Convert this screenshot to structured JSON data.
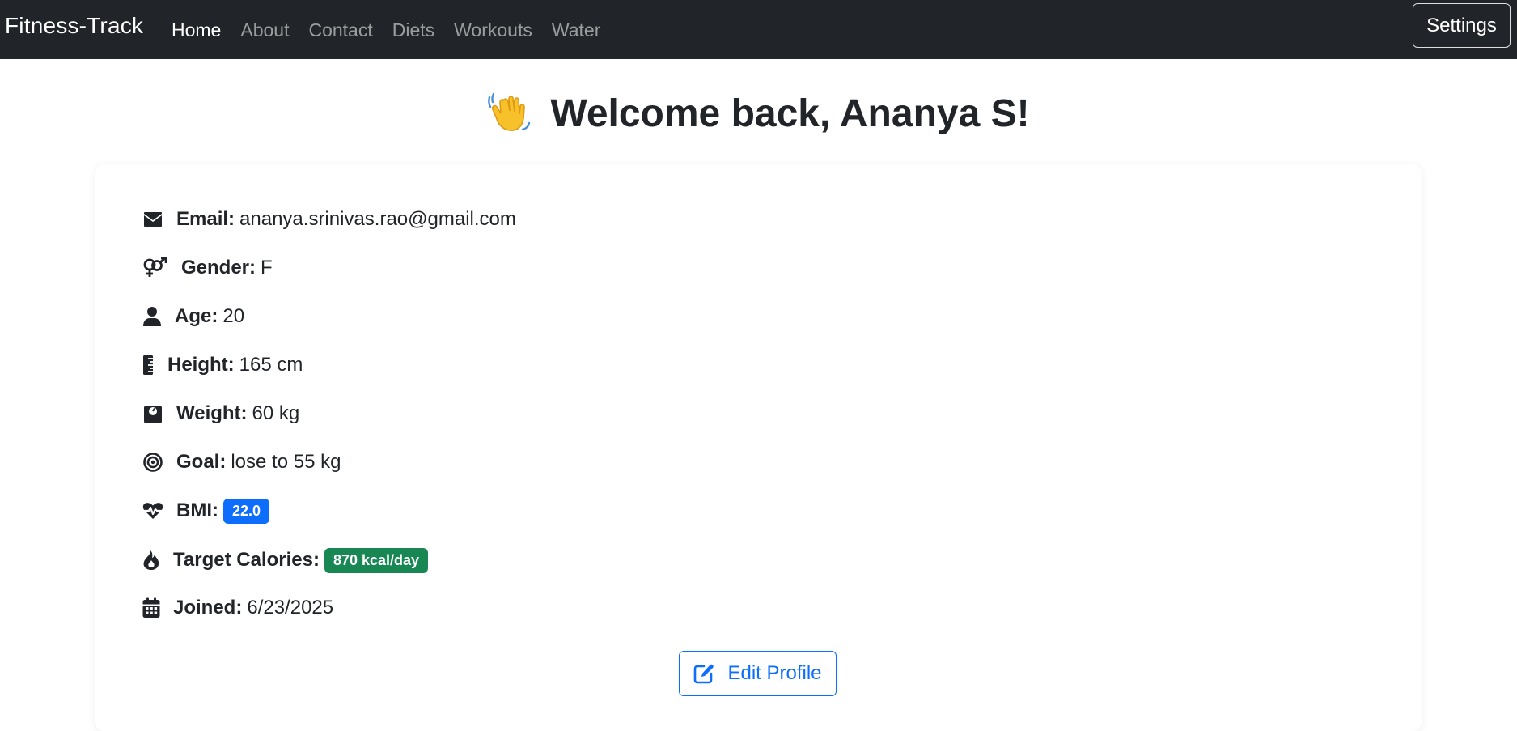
{
  "navbar": {
    "brand": "Fitness-Track",
    "links": [
      {
        "label": "Home",
        "active": true
      },
      {
        "label": "About",
        "active": false
      },
      {
        "label": "Contact",
        "active": false
      },
      {
        "label": "Diets",
        "active": false
      },
      {
        "label": "Workouts",
        "active": false
      },
      {
        "label": "Water",
        "active": false
      }
    ],
    "settings_label": "Settings"
  },
  "heading": {
    "icon": "waving-hand-icon",
    "text": "Welcome back, Ananya S!"
  },
  "profile": {
    "email": {
      "icon": "envelope-icon",
      "label": "Email:",
      "value": "ananya.srinivas.rao@gmail.com"
    },
    "gender": {
      "icon": "gender-icon",
      "label": "Gender:",
      "value": "F"
    },
    "age": {
      "icon": "user-icon",
      "label": "Age:",
      "value": "20"
    },
    "height": {
      "icon": "ruler-icon",
      "label": "Height:",
      "value": "165 cm"
    },
    "weight": {
      "icon": "weight-scale-icon",
      "label": "Weight:",
      "value": "60 kg"
    },
    "goal": {
      "icon": "target-icon",
      "label": "Goal:",
      "value": "lose to 55 kg"
    },
    "bmi": {
      "icon": "heart-pulse-icon",
      "label": "BMI:",
      "value": "22.0"
    },
    "target_calories": {
      "icon": "fire-icon",
      "label": "Target Calories:",
      "value": "870 kcal/day"
    },
    "joined": {
      "icon": "calendar-icon",
      "label": "Joined:",
      "value": "6/23/2025"
    }
  },
  "edit_profile": {
    "icon": "edit-icon",
    "label": "Edit Profile"
  },
  "colors": {
    "navbar_bg": "#212529",
    "primary": "#0d6efd",
    "success": "#198754",
    "text": "#212529"
  }
}
